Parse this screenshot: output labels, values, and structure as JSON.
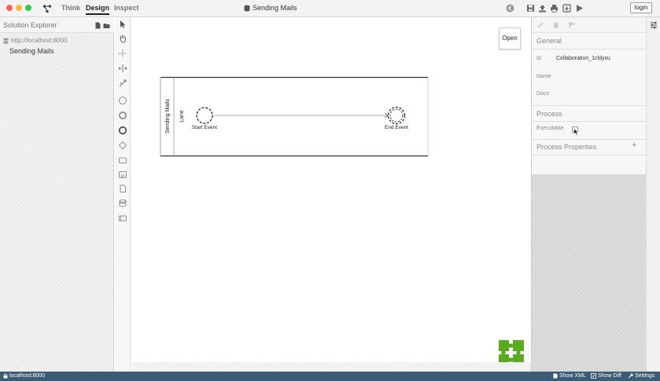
{
  "header": {
    "tabs": [
      {
        "label": "Think"
      },
      {
        "label": "Design"
      },
      {
        "label": "Inspect"
      }
    ],
    "title": "Sending Mails",
    "login_label": "login"
  },
  "solution_explorer": {
    "title": "Solution Explorer",
    "server": "http://localhost:8000",
    "items": [
      {
        "label": "Sending Mails"
      }
    ]
  },
  "canvas": {
    "open_label": "Open",
    "pool_label": "Sending Mails",
    "lane_label": "Lane",
    "start_event_label": "Start Event",
    "end_event_label": "End Event"
  },
  "properties": {
    "general_title": "General",
    "id_label": "Id",
    "id_value": "Collaboration_1cldyxu",
    "name_label": "Name",
    "docs_label": "Docs",
    "process_title": "Process",
    "executable_label": "Executable",
    "process_properties_title": "Process Properties",
    "add_label": "+"
  },
  "status": {
    "server": "localhost:8000",
    "show_xml": "Show XML",
    "show_diff": "Show Diff",
    "settings": "Settings"
  },
  "colors": {
    "status_bar": "#3b5c74",
    "logo_green": "#5aaa1f"
  }
}
